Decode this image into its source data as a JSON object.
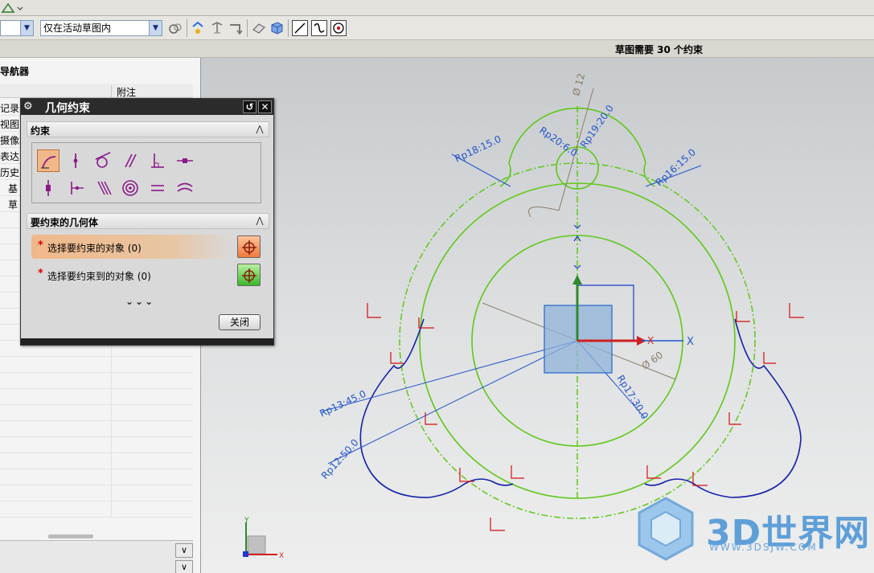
{
  "top_strip": {
    "icon": "sketch-icon"
  },
  "toolbar": {
    "filter_value": "",
    "scope_value": "仅在活动草图内",
    "icons": [
      "quickpick-icon",
      "snap-point-icon",
      "snap-curve-icon",
      "snap-arrow-icon",
      "eraser-icon",
      "shaded-cube-icon",
      "line-tool-icon",
      "arc-tool-icon",
      "point-tool-icon"
    ]
  },
  "status": {
    "text": "草图需要 30 个约束"
  },
  "navigator": {
    "title": "导航器",
    "column_note": "附注",
    "rows": [
      {
        "label": "记录"
      },
      {
        "label": "视图"
      },
      {
        "label": "摄像机"
      },
      {
        "label": "表达"
      },
      {
        "label": "历史"
      },
      {
        "label": "基"
      },
      {
        "label": "草"
      }
    ]
  },
  "dialog": {
    "title": "几何约束",
    "section_constraints": "约束",
    "section_geometry": "要约束的几何体",
    "select_object": "选择要约束的对象 (0)",
    "select_target": "选择要约束到的对象 (0)",
    "close_label": "关闭",
    "constraint_icons": [
      "coincident-icon",
      "point-on-curve-icon",
      "tangent-icon",
      "parallel-icon",
      "perpendicular-icon",
      "horizontal-icon",
      "vertical-icon",
      "midpoint-icon",
      "collinear-icon",
      "concentric-icon",
      "equal-length-icon",
      "equal-radius-icon"
    ]
  },
  "viewport": {
    "dim_labels": {
      "d12": "Ø 12",
      "p20": "Rp20:6.0",
      "p19": "Rp19:20.0",
      "p18": "Rp18:15.0",
      "p16": "Rp16:15.0",
      "d60": "Ø 60",
      "p17": "Rp17:30.0",
      "p13": "Rp13:45.0",
      "p12": "Rp12:50.0"
    },
    "axis_x": "X",
    "axis_x2": "X",
    "small_axis_x": "X",
    "small_axis_y": "Y"
  },
  "watermark": {
    "text": "3D世界网",
    "url": "WWW.3DSJW.COM"
  },
  "colors": {
    "sketch_green": "#5fc81a",
    "curve_blue": "#1423a8",
    "dimension_blue": "#2255cc",
    "accent_orange": "#f07a3c"
  }
}
